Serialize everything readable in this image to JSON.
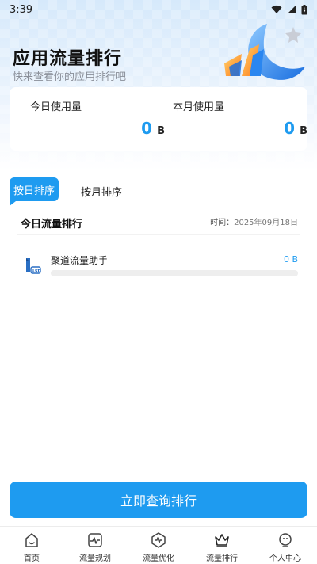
{
  "status_bar": {
    "time": "3:39"
  },
  "header": {
    "title": "应用流量排行",
    "subtitle": "快来查看你的应用排行吧"
  },
  "usage": {
    "today": {
      "label": "今日使用量",
      "value": "0",
      "unit": "B"
    },
    "month": {
      "label": "本月使用量",
      "value": "0",
      "unit": "B"
    }
  },
  "tabs": [
    {
      "label": "按日排序",
      "active": true
    },
    {
      "label": "按月排序",
      "active": false
    }
  ],
  "ranking": {
    "title": "今日流量排行",
    "time_label": "时间：",
    "date": "2025年09月18日",
    "items": [
      {
        "rank": "1st",
        "name": "聚道流量助手",
        "value": "0 B",
        "progress": 0
      }
    ]
  },
  "action_button": {
    "label": "立即查询排行"
  },
  "bottom_nav": [
    {
      "label": "首页",
      "icon": "home-icon"
    },
    {
      "label": "流量规划",
      "icon": "chart-pulse-icon"
    },
    {
      "label": "流量优化",
      "icon": "shield-pulse-icon"
    },
    {
      "label": "流量排行",
      "icon": "crown-icon"
    },
    {
      "label": "个人中心",
      "icon": "user-icon"
    }
  ],
  "colors": {
    "accent": "#1e9bf0"
  }
}
